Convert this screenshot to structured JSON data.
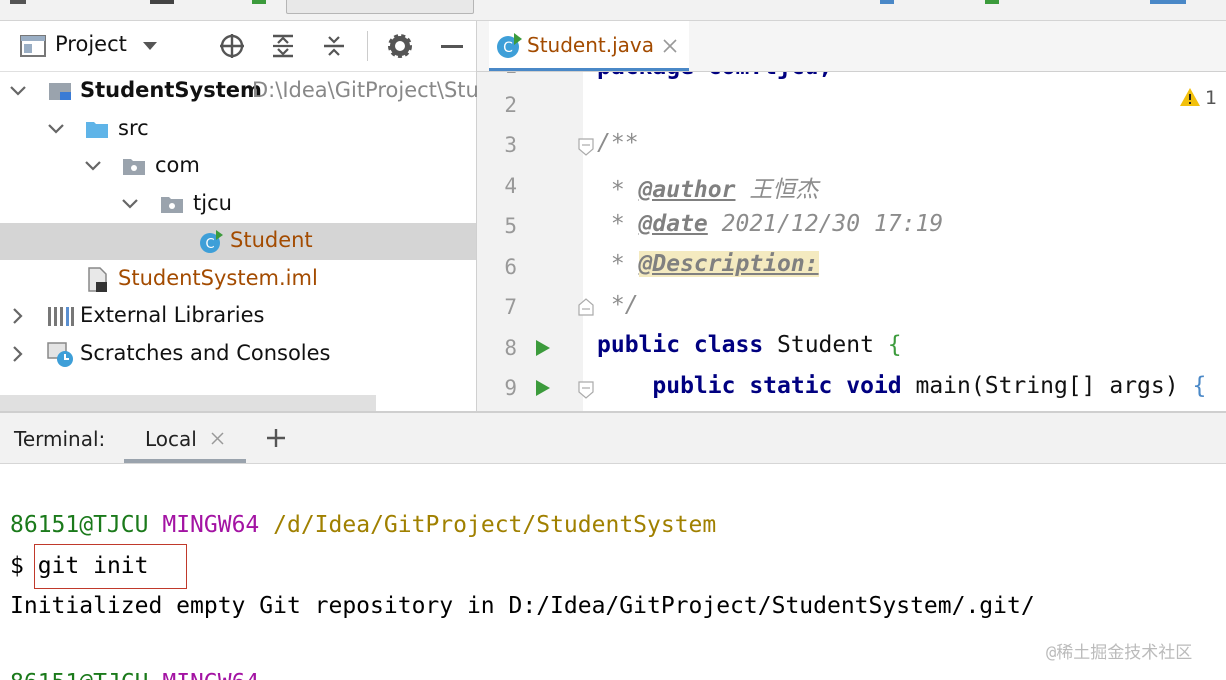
{
  "project_panel": {
    "title": "Project",
    "tree": [
      {
        "label": "StudentSystem",
        "path": "D:\\Idea\\GitProject\\Stu"
      },
      {
        "label": "src"
      },
      {
        "label": "com"
      },
      {
        "label": "tjcu"
      },
      {
        "label": "Student"
      },
      {
        "label": "StudentSystem.iml"
      },
      {
        "label": "External Libraries"
      },
      {
        "label": "Scratches and Consoles"
      }
    ]
  },
  "editor": {
    "tab_label": "Student.java",
    "tab_icon_letter": "C",
    "warning_count": "1",
    "line_numbers": [
      "2",
      "3",
      "4",
      "5",
      "6",
      "7",
      "8",
      "9"
    ],
    "code": {
      "line1_partial": "package com.tjcu;",
      "line3": "/**",
      "line4_star": " * ",
      "line4_tag": "@author",
      "line4_text": " 王恒杰",
      "line5_star": " * ",
      "line5_tag": "@date",
      "line5_text": " 2021/12/30 17:19",
      "line6_star": " * ",
      "line6_tag": "@Description:",
      "line7": " */",
      "line8_kw": "public class",
      "line8_rest": " Student ",
      "line8_brace": "{",
      "line9_kw": "    public static void",
      "line9_rest": " main(String[] args) ",
      "line9_brace": "{"
    }
  },
  "terminal": {
    "label": "Terminal:",
    "tab_local": "Local",
    "user_host": "86151@TJCU",
    "mingw": "MINGW64",
    "cwd": "/d/Idea/GitProject/StudentSystem",
    "prompt": "$ ",
    "command": "git init",
    "output": "Initialized empty Git repository in D:/Idea/GitProject/StudentSystem/.git/"
  },
  "watermark": "@稀土掘金技术社区",
  "colors": {
    "selection": "#d5d5d5",
    "keyword": "#000080",
    "terminal_green": "#1b7a1b",
    "terminal_magenta": "#a313a3",
    "terminal_olive": "#a08000",
    "highlight_box": "#c0392b"
  }
}
